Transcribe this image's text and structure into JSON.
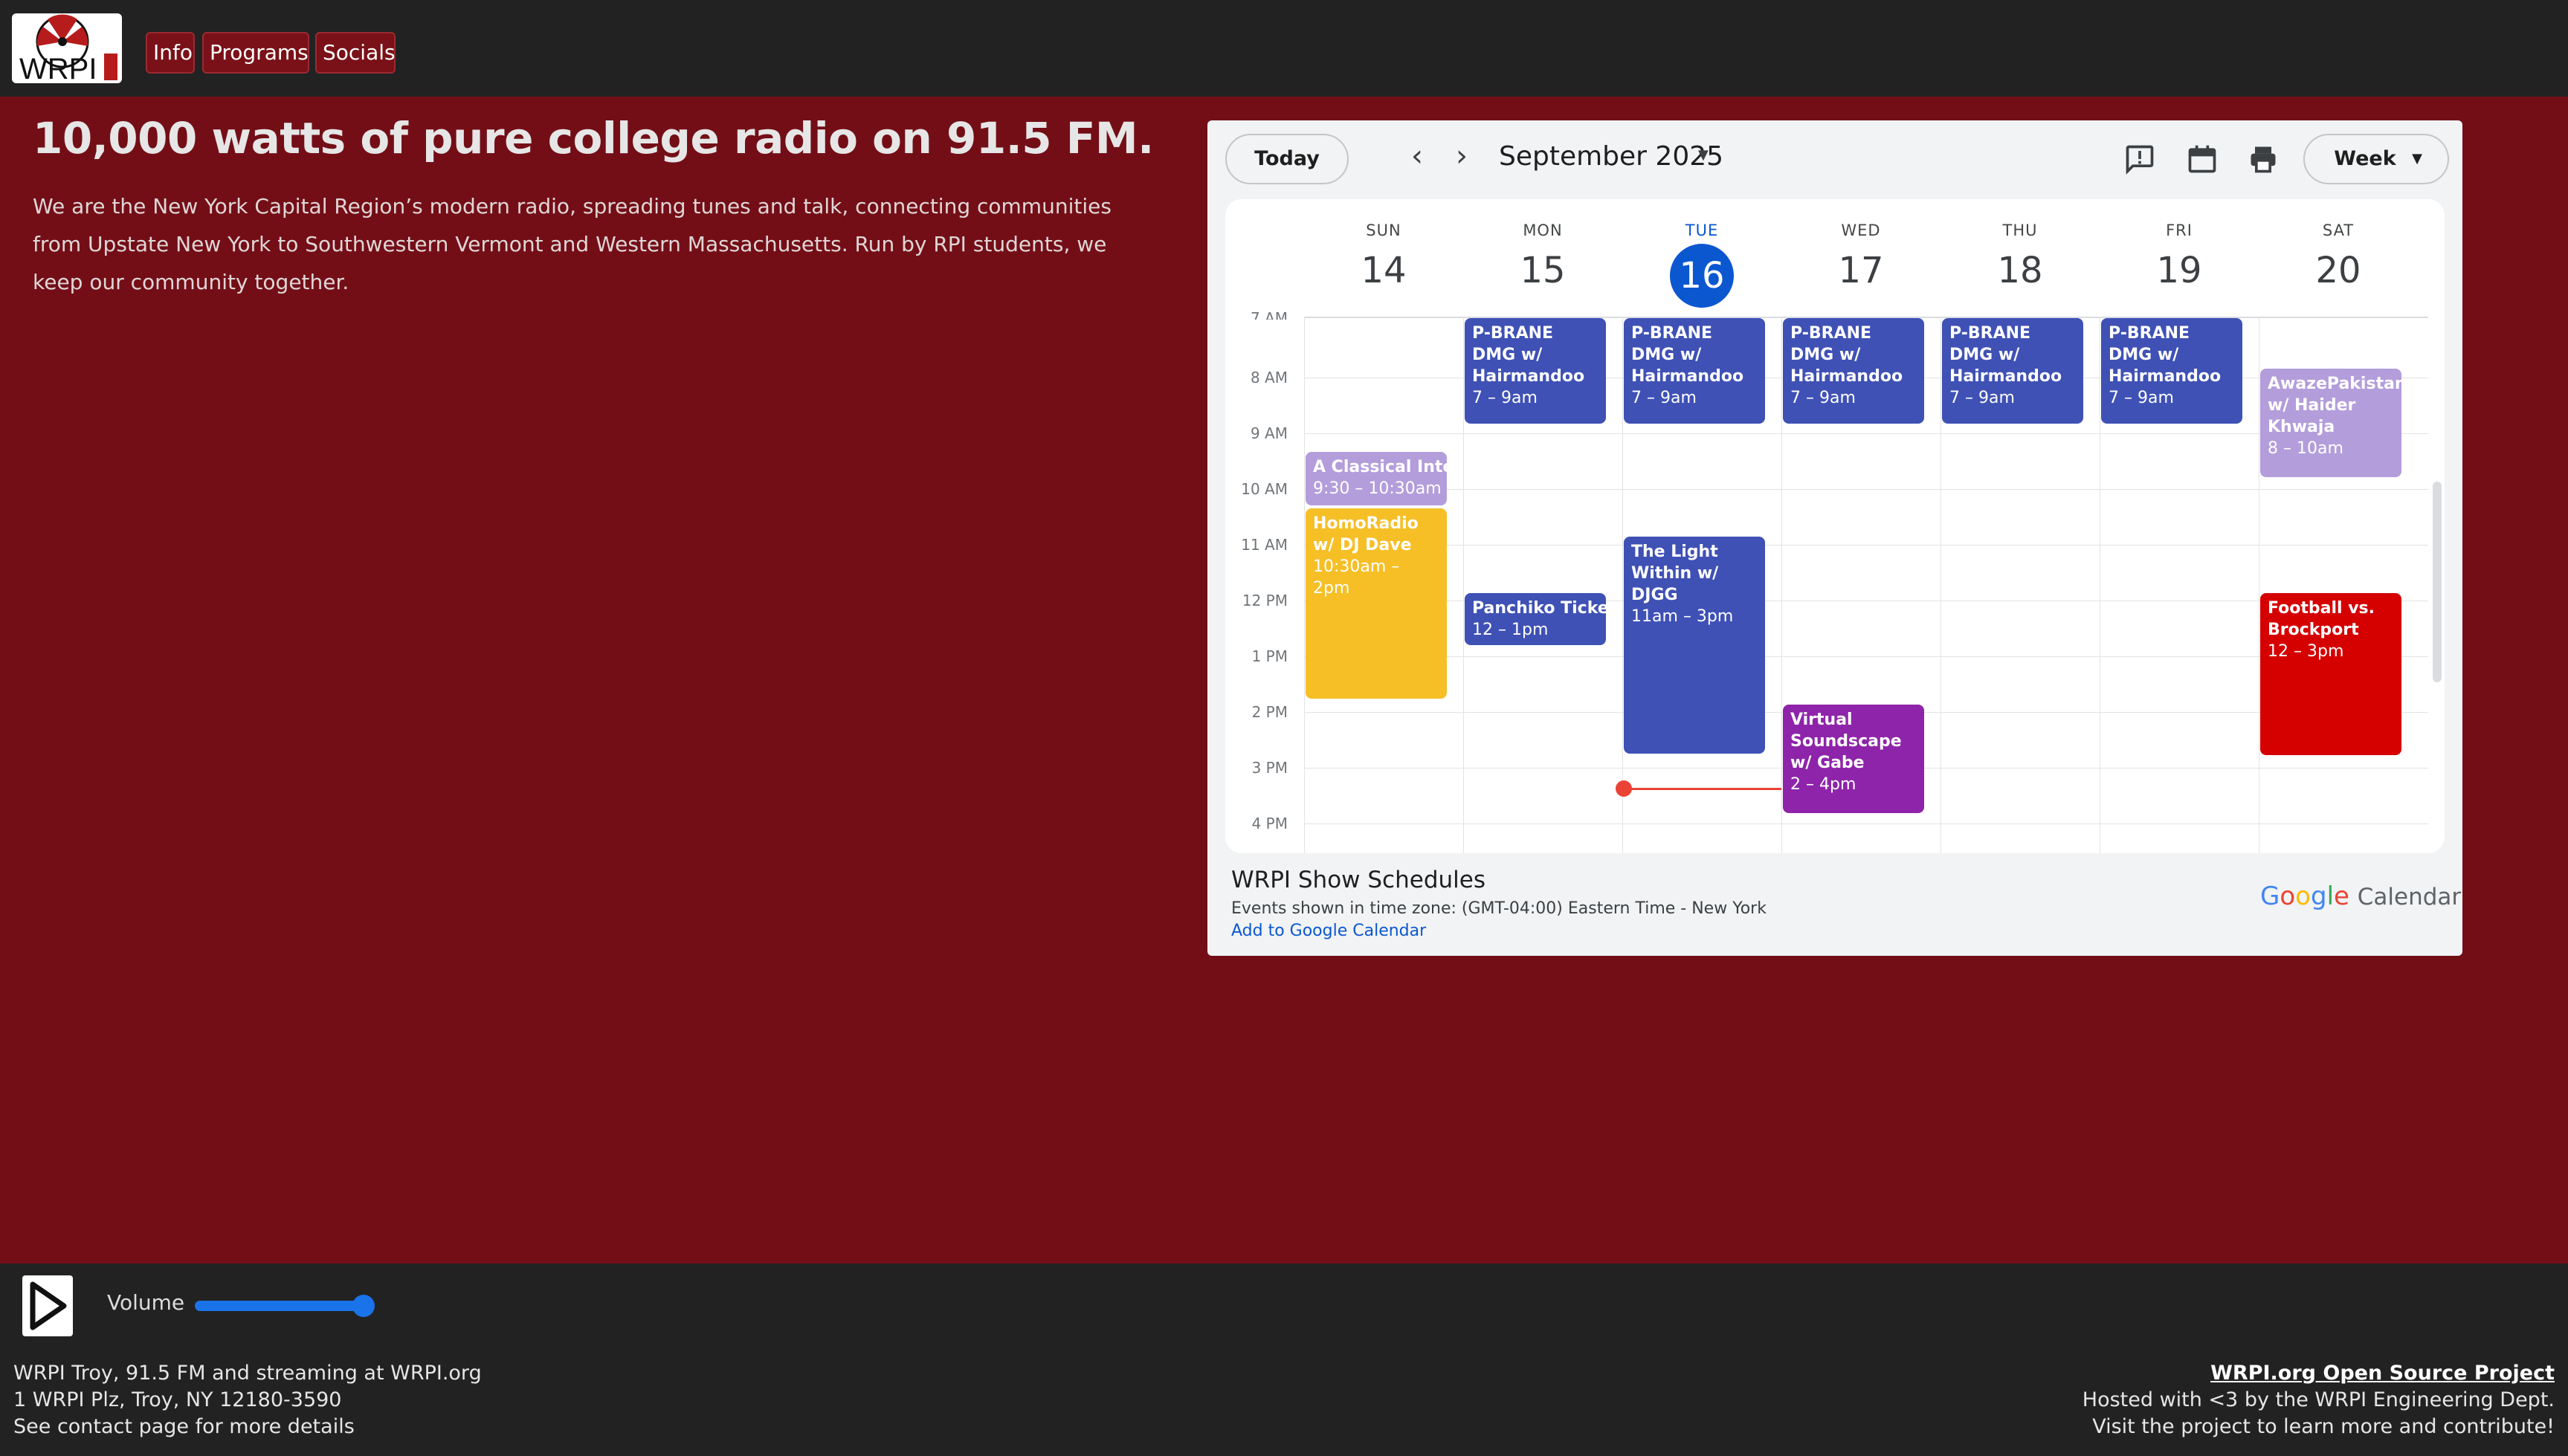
{
  "nav": {
    "logo_text": "WRPI",
    "items": [
      "Info",
      "Programs",
      "Socials"
    ]
  },
  "hero": {
    "headline": "10,000 watts of pure college radio on 91.5 FM.",
    "description": "We are the New York Capital Region’s modern radio, spreading tunes and talk, connecting communities from Upstate New York to Southwestern Vermont and Western Massachusetts. Run by RPI students, we keep our community together."
  },
  "calendar": {
    "today_label": "Today",
    "month_label": "September 2025",
    "view_label": "Week",
    "days": [
      {
        "name": "SUN",
        "num": "14"
      },
      {
        "name": "MON",
        "num": "15"
      },
      {
        "name": "TUE",
        "num": "16"
      },
      {
        "name": "WED",
        "num": "17"
      },
      {
        "name": "THU",
        "num": "18"
      },
      {
        "name": "FRI",
        "num": "19"
      },
      {
        "name": "SAT",
        "num": "20"
      }
    ],
    "times": [
      "7 AM",
      "8 AM",
      "9 AM",
      "10 AM",
      "11 AM",
      "12 PM",
      "1 PM",
      "2 PM",
      "3 PM",
      "4 PM"
    ],
    "events": [
      {
        "title": "P-BRANE DMG w/ Hairmandoo",
        "time": "7 – 9am"
      },
      {
        "title": "P-BRANE DMG w/ Hairmandoo",
        "time": "7 – 9am"
      },
      {
        "title": "P-BRANE DMG w/ Hairmandoo",
        "time": "7 – 9am"
      },
      {
        "title": "P-BRANE DMG w/ Hairmandoo",
        "time": "7 – 9am"
      },
      {
        "title": "P-BRANE DMG w/ Hairmandoo",
        "time": "7 – 9am"
      },
      {
        "title": "AwazePakistan w/ Haider Khwaja",
        "time": "8 – 10am"
      },
      {
        "title": "A Classical Interl",
        "time": "9:30 – 10:30am"
      },
      {
        "title": "HomoRadio w/ DJ Dave",
        "time": "10:30am – 2pm"
      },
      {
        "title": "The Light Within w/ DJGG",
        "time": "11am – 3pm"
      },
      {
        "title": "Panchiko Ticket G",
        "time": "12 – 1pm"
      },
      {
        "title": "Football vs. Brockport",
        "time": "12 – 3pm"
      },
      {
        "title": "Virtual Soundscape w/ Gabe",
        "time": "2 – 4pm"
      }
    ],
    "footer_title": "WRPI Show Schedules",
    "timezone": "Events shown in time zone: (GMT-04:00) Eastern Time - New York",
    "add_link": "Add to Google Calendar",
    "brand_google": "Google",
    "brand_calendar": "Calendar"
  },
  "player": {
    "volume_label": "Volume",
    "volume_level": 0.95
  },
  "footer": {
    "left": [
      "WRPI Troy, 91.5 FM and streaming at WRPI.org",
      "1 WRPI Plz, Troy, NY 12180-3590",
      "See contact page for more details"
    ],
    "project_link": "WRPI.org Open Source Project",
    "right": [
      "Hosted with <3 by the WRPI Engineering Dept.",
      "Visit the project to learn more and contribute!"
    ]
  },
  "colors": {
    "page_bg": "#730e17",
    "bar_bg": "#222223",
    "accent_blue": "#0b57d0",
    "event_blue": "#3f51b5",
    "event_lavender": "#b39ddb",
    "event_yellow": "#f6bf26",
    "event_purple": "#8e24aa",
    "event_red": "#d50000"
  }
}
